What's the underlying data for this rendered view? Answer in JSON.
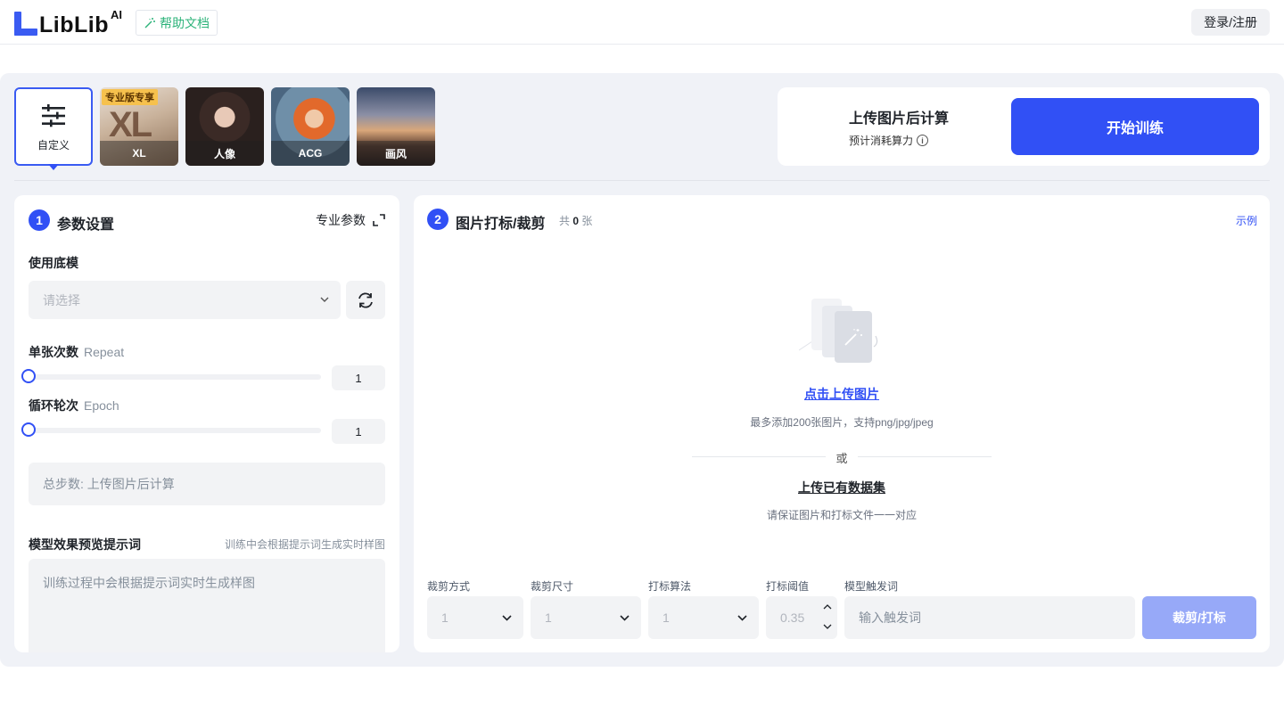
{
  "header": {
    "logo_text": "LibLib",
    "logo_ai": "AI",
    "help_label": "帮助文档",
    "login_label": "登录/注册"
  },
  "presets": [
    {
      "label": "自定义",
      "icon": "sliders-icon"
    },
    {
      "label": "XL",
      "badge": "专业版专享"
    },
    {
      "label": "人像"
    },
    {
      "label": "ACG"
    },
    {
      "label": "画风"
    }
  ],
  "cost": {
    "title": "上传图片后计算",
    "subtitle": "预计消耗算力",
    "info_icon": "i",
    "train_button": "开始训练"
  },
  "params": {
    "step": "1",
    "title": "参数设置",
    "pro_label": "专业参数",
    "base_model_label": "使用底模",
    "base_model_placeholder": "请选择",
    "repeat_label": "单张次数",
    "repeat_en": "Repeat",
    "repeat_value": "1",
    "epoch_label": "循环轮次",
    "epoch_en": "Epoch",
    "epoch_value": "1",
    "total_steps": "总步数: 上传图片后计算",
    "prompt_label": "模型效果预览提示词",
    "prompt_hint": "训练中会根据提示词生成实时样图",
    "prompt_placeholder": "训练过程中会根据提示词实时生成样图"
  },
  "images": {
    "step": "2",
    "title": "图片打标/裁剪",
    "count_prefix": "共",
    "count_value": "0",
    "count_suffix": "张",
    "example_link": "示例",
    "upload_link": "点击上传图片",
    "upload_hint": "最多添加200张图片，支持png/jpg/jpeg",
    "or_text": "或",
    "dataset_link": "上传已有数据集",
    "dataset_hint": "请保证图片和打标文件一一对应",
    "crop_mode_label": "裁剪方式",
    "crop_mode_value": "1",
    "crop_size_label": "裁剪尺寸",
    "crop_size_value": "1",
    "tag_algo_label": "打标算法",
    "tag_algo_value": "1",
    "tag_threshold_label": "打标阈值",
    "tag_threshold_value": "0.35",
    "trigger_label": "模型触发词",
    "trigger_placeholder": "输入触发词",
    "crop_button": "裁剪/打标"
  },
  "colors": {
    "accent": "#3150f5",
    "help_green": "#2db37a",
    "disabled_button": "#97a9f8"
  }
}
